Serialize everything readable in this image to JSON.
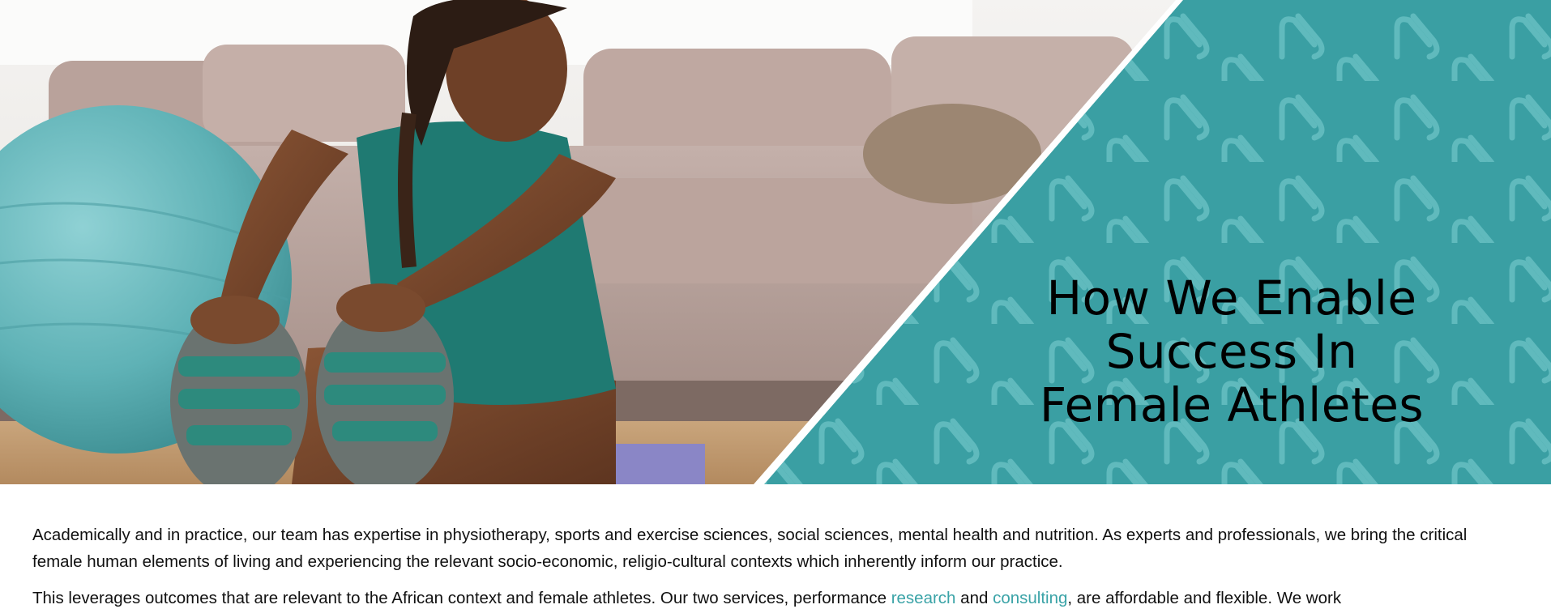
{
  "hero": {
    "image_alt": "woman stretching on floor next to teal exercise ball",
    "title_lines": [
      "How We Enable",
      "Success In",
      "Female Athletes"
    ],
    "pattern_icon": "ns-monogram-icon",
    "colors": {
      "teal": "#3a9fa3",
      "pattern": "#6cc3c6",
      "divider": "#ffffff"
    }
  },
  "content": {
    "paragraph1": "Academically and in practice, our team has expertise in physiotherapy, sports and exercise sciences, social sciences, mental health and nutrition. As experts and professionals, we bring the critical female human elements of living and experiencing the relevant socio-economic, religio-cultural contexts which inherently inform our practice.",
    "paragraph2_before": "This leverages outcomes that are relevant to the African context and female athletes. Our two services, performance ",
    "link_research": "research",
    "paragraph2_mid": " and ",
    "link_consulting": "consulting",
    "paragraph2_after": ", are affordable and flexible. We work"
  }
}
